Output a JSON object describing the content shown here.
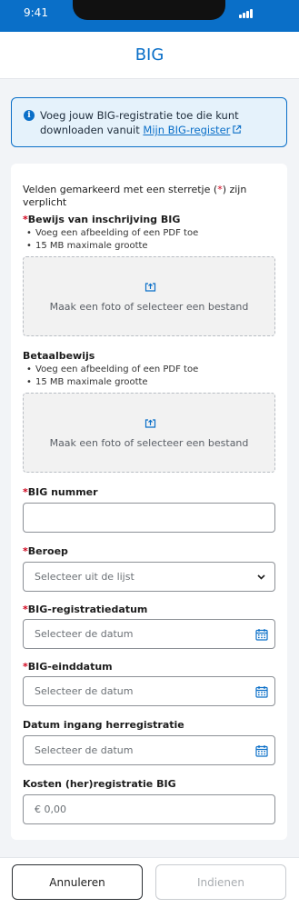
{
  "status_bar": {
    "time": "9:41"
  },
  "header": {
    "title": "BIG"
  },
  "info_banner": {
    "text": "Voeg jouw BIG-registratie toe die kunt downloaden vanuit",
    "link_label": "Mijn BIG-register"
  },
  "form": {
    "required_note_before": "Velden gemarkeerd met een sterretje (",
    "required_star": "*",
    "required_note_after": ") zijn verplicht",
    "star": "*",
    "bewijs": {
      "label": "Bewijs van inschrijving BIG",
      "bullets": [
        "Voeg een afbeelding of een PDF toe",
        "15 MB maximale grootte"
      ],
      "upload_text": "Maak een foto of selecteer een bestand"
    },
    "betaalbewijs": {
      "label": "Betaalbewijs",
      "bullets": [
        "Voeg een afbeelding of een PDF toe",
        "15 MB maximale grootte"
      ],
      "upload_text": "Maak een foto of selecteer een bestand"
    },
    "big_nummer": {
      "label": "BIG nummer",
      "value": ""
    },
    "beroep": {
      "label": "Beroep",
      "placeholder": "Selecteer uit de lijst"
    },
    "registratiedatum": {
      "label": "BIG-registratiedatum",
      "placeholder": "Selecteer de datum"
    },
    "einddatum": {
      "label": "BIG-einddatum",
      "placeholder": "Selecteer de datum"
    },
    "herregistratie": {
      "label": "Datum ingang herregistratie",
      "placeholder": "Selecteer de datum"
    },
    "kosten": {
      "label": "Kosten (her)registratie BIG",
      "placeholder": "€ 0,00"
    }
  },
  "footer": {
    "cancel_label": "Annuleren",
    "submit_label": "Indienen"
  },
  "colors": {
    "primary": "#0a6fc8",
    "required": "#d0021b",
    "disabled": "#a8acb0"
  },
  "icons": {
    "info": "info-icon",
    "external_link": "external-link-icon",
    "upload": "upload-icon",
    "calendar": "calendar-icon",
    "chevron": "chevron-down-icon"
  }
}
